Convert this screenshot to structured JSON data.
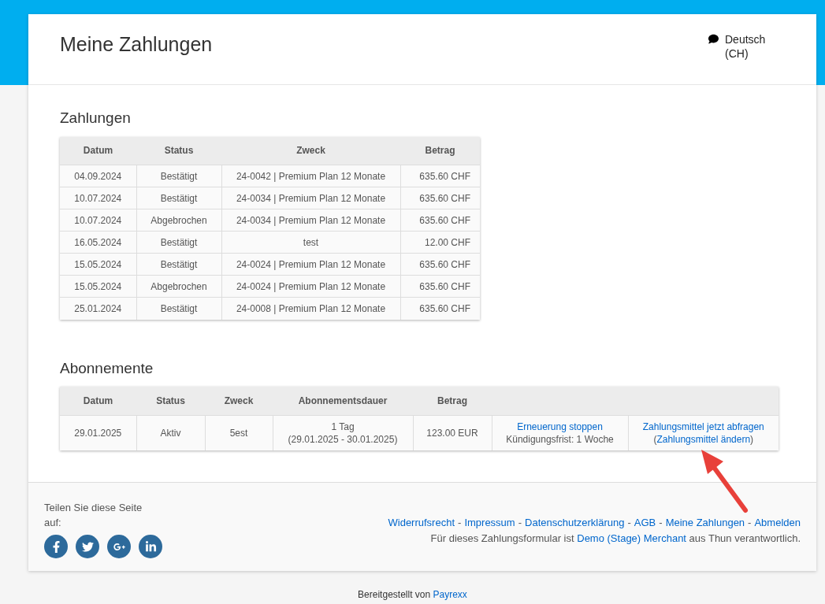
{
  "header": {
    "title": "Meine Zahlungen",
    "language": "Deutsch (CH)"
  },
  "payments": {
    "title": "Zahlungen",
    "columns": [
      "Datum",
      "Status",
      "Zweck",
      "Betrag"
    ],
    "rows": [
      [
        "04.09.2024",
        "Bestätigt",
        "24-0042 | Premium Plan 12 Monate",
        "635.60 CHF"
      ],
      [
        "10.07.2024",
        "Bestätigt",
        "24-0034 | Premium Plan 12 Monate",
        "635.60 CHF"
      ],
      [
        "10.07.2024",
        "Abgebrochen",
        "24-0034 | Premium Plan 12 Monate",
        "635.60 CHF"
      ],
      [
        "16.05.2024",
        "Bestätigt",
        "test",
        "12.00 CHF"
      ],
      [
        "15.05.2024",
        "Bestätigt",
        "24-0024 | Premium Plan 12 Monate",
        "635.60 CHF"
      ],
      [
        "15.05.2024",
        "Abgebrochen",
        "24-0024 | Premium Plan 12 Monate",
        "635.60 CHF"
      ],
      [
        "25.01.2024",
        "Bestätigt",
        "24-0008 | Premium Plan 12 Monate",
        "635.60 CHF"
      ]
    ]
  },
  "subscriptions": {
    "title": "Abonnemente",
    "columns": [
      "Datum",
      "Status",
      "Zweck",
      "Abonnementsdauer",
      "Betrag"
    ],
    "rows": [
      {
        "date": "29.01.2025",
        "status": "Aktiv",
        "purpose": "5est",
        "duration": "1 Tag",
        "duration_range": "(29.01.2025 - 30.01.2025)",
        "amount": "123.00 EUR",
        "stop_link": "Erneuerung stoppen",
        "notice": "Kündigungsfrist: 1 Woche",
        "request_link": "Zahlungsmittel jetzt abfragen",
        "change_before": "(",
        "change_link": "Zahlungsmittel ändern",
        "change_after": ")"
      }
    ]
  },
  "footer": {
    "share_label": "Teilen Sie diese Seite auf:",
    "share_buttons": [
      {
        "kind": "facebook"
      },
      {
        "kind": "twitter"
      },
      {
        "kind": "googleplus"
      },
      {
        "kind": "linkedin"
      }
    ],
    "links": [
      "Widerrufsrecht",
      "Impressum",
      "Datenschutzerklärung",
      "AGB",
      "Meine Zahlungen",
      "Abmelden"
    ],
    "separator": "-",
    "note_before": "Für dieses Zahlungsformular ist",
    "note_link": "Demo (Stage) Merchant",
    "note_after": "aus Thun verantwortlich."
  },
  "powered_by": {
    "text": "Bereitgestellt von",
    "link": "Payrexx"
  },
  "annotation": {
    "kind": "arrow"
  }
}
